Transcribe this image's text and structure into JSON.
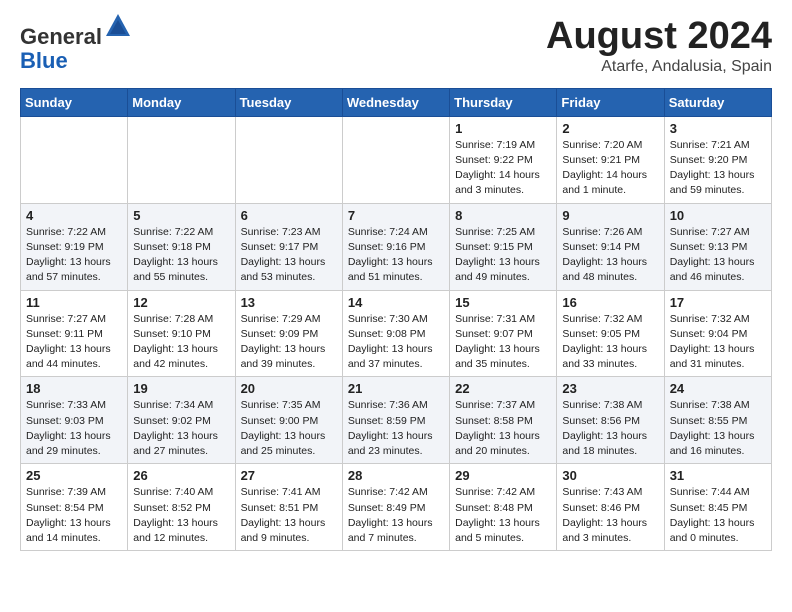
{
  "logo": {
    "general": "General",
    "blue": "Blue"
  },
  "title": {
    "month_year": "August 2024",
    "location": "Atarfe, Andalusia, Spain"
  },
  "days_of_week": [
    "Sunday",
    "Monday",
    "Tuesday",
    "Wednesday",
    "Thursday",
    "Friday",
    "Saturday"
  ],
  "weeks": [
    [
      {
        "num": "",
        "info": ""
      },
      {
        "num": "",
        "info": ""
      },
      {
        "num": "",
        "info": ""
      },
      {
        "num": "",
        "info": ""
      },
      {
        "num": "1",
        "info": "Sunrise: 7:19 AM\nSunset: 9:22 PM\nDaylight: 14 hours\nand 3 minutes."
      },
      {
        "num": "2",
        "info": "Sunrise: 7:20 AM\nSunset: 9:21 PM\nDaylight: 14 hours\nand 1 minute."
      },
      {
        "num": "3",
        "info": "Sunrise: 7:21 AM\nSunset: 9:20 PM\nDaylight: 13 hours\nand 59 minutes."
      }
    ],
    [
      {
        "num": "4",
        "info": "Sunrise: 7:22 AM\nSunset: 9:19 PM\nDaylight: 13 hours\nand 57 minutes."
      },
      {
        "num": "5",
        "info": "Sunrise: 7:22 AM\nSunset: 9:18 PM\nDaylight: 13 hours\nand 55 minutes."
      },
      {
        "num": "6",
        "info": "Sunrise: 7:23 AM\nSunset: 9:17 PM\nDaylight: 13 hours\nand 53 minutes."
      },
      {
        "num": "7",
        "info": "Sunrise: 7:24 AM\nSunset: 9:16 PM\nDaylight: 13 hours\nand 51 minutes."
      },
      {
        "num": "8",
        "info": "Sunrise: 7:25 AM\nSunset: 9:15 PM\nDaylight: 13 hours\nand 49 minutes."
      },
      {
        "num": "9",
        "info": "Sunrise: 7:26 AM\nSunset: 9:14 PM\nDaylight: 13 hours\nand 48 minutes."
      },
      {
        "num": "10",
        "info": "Sunrise: 7:27 AM\nSunset: 9:13 PM\nDaylight: 13 hours\nand 46 minutes."
      }
    ],
    [
      {
        "num": "11",
        "info": "Sunrise: 7:27 AM\nSunset: 9:11 PM\nDaylight: 13 hours\nand 44 minutes."
      },
      {
        "num": "12",
        "info": "Sunrise: 7:28 AM\nSunset: 9:10 PM\nDaylight: 13 hours\nand 42 minutes."
      },
      {
        "num": "13",
        "info": "Sunrise: 7:29 AM\nSunset: 9:09 PM\nDaylight: 13 hours\nand 39 minutes."
      },
      {
        "num": "14",
        "info": "Sunrise: 7:30 AM\nSunset: 9:08 PM\nDaylight: 13 hours\nand 37 minutes."
      },
      {
        "num": "15",
        "info": "Sunrise: 7:31 AM\nSunset: 9:07 PM\nDaylight: 13 hours\nand 35 minutes."
      },
      {
        "num": "16",
        "info": "Sunrise: 7:32 AM\nSunset: 9:05 PM\nDaylight: 13 hours\nand 33 minutes."
      },
      {
        "num": "17",
        "info": "Sunrise: 7:32 AM\nSunset: 9:04 PM\nDaylight: 13 hours\nand 31 minutes."
      }
    ],
    [
      {
        "num": "18",
        "info": "Sunrise: 7:33 AM\nSunset: 9:03 PM\nDaylight: 13 hours\nand 29 minutes."
      },
      {
        "num": "19",
        "info": "Sunrise: 7:34 AM\nSunset: 9:02 PM\nDaylight: 13 hours\nand 27 minutes."
      },
      {
        "num": "20",
        "info": "Sunrise: 7:35 AM\nSunset: 9:00 PM\nDaylight: 13 hours\nand 25 minutes."
      },
      {
        "num": "21",
        "info": "Sunrise: 7:36 AM\nSunset: 8:59 PM\nDaylight: 13 hours\nand 23 minutes."
      },
      {
        "num": "22",
        "info": "Sunrise: 7:37 AM\nSunset: 8:58 PM\nDaylight: 13 hours\nand 20 minutes."
      },
      {
        "num": "23",
        "info": "Sunrise: 7:38 AM\nSunset: 8:56 PM\nDaylight: 13 hours\nand 18 minutes."
      },
      {
        "num": "24",
        "info": "Sunrise: 7:38 AM\nSunset: 8:55 PM\nDaylight: 13 hours\nand 16 minutes."
      }
    ],
    [
      {
        "num": "25",
        "info": "Sunrise: 7:39 AM\nSunset: 8:54 PM\nDaylight: 13 hours\nand 14 minutes."
      },
      {
        "num": "26",
        "info": "Sunrise: 7:40 AM\nSunset: 8:52 PM\nDaylight: 13 hours\nand 12 minutes."
      },
      {
        "num": "27",
        "info": "Sunrise: 7:41 AM\nSunset: 8:51 PM\nDaylight: 13 hours\nand 9 minutes."
      },
      {
        "num": "28",
        "info": "Sunrise: 7:42 AM\nSunset: 8:49 PM\nDaylight: 13 hours\nand 7 minutes."
      },
      {
        "num": "29",
        "info": "Sunrise: 7:42 AM\nSunset: 8:48 PM\nDaylight: 13 hours\nand 5 minutes."
      },
      {
        "num": "30",
        "info": "Sunrise: 7:43 AM\nSunset: 8:46 PM\nDaylight: 13 hours\nand 3 minutes."
      },
      {
        "num": "31",
        "info": "Sunrise: 7:44 AM\nSunset: 8:45 PM\nDaylight: 13 hours\nand 0 minutes."
      }
    ]
  ]
}
